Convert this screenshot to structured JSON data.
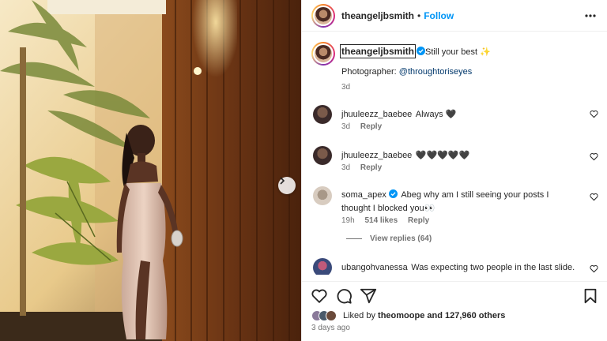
{
  "post": {
    "author": "theangeljbsmith",
    "follow_label": "Follow",
    "more_icon": "more-options-icon",
    "caption": {
      "username": "theangeljbsmith",
      "text": "Still your best ✨",
      "credit_prefix": "Photographer: ",
      "credit_handle": "@throughtoriseyes",
      "time": "3d"
    }
  },
  "comments": [
    {
      "username": "jhuuleezz_baebee",
      "text": "Always 🖤",
      "time": "3d",
      "reply": "Reply",
      "verified": false
    },
    {
      "username": "jhuuleezz_baebee",
      "text": "🖤🖤🖤🖤🖤",
      "time": "3d",
      "reply": "Reply",
      "verified": false
    },
    {
      "username": "soma_apex",
      "text": "Abeg why am I still seeing your posts I thought I blocked you👀",
      "time": "19h",
      "likes": "514 likes",
      "reply": "Reply",
      "verified": true
    },
    {
      "username": "ubangohvanessa",
      "text": "Was expecting two people in the last slide.",
      "time": "",
      "reply": "",
      "verified": false
    }
  ],
  "view_replies": "View replies (64)",
  "likes": {
    "prefix": "Liked by ",
    "user": "theomoope",
    "suffix": " and 127,960 others"
  },
  "date": "3 days ago",
  "colors": {
    "link_blue": "#0095f6",
    "verified_blue": "#0095f6",
    "text": "#262626",
    "muted": "#737373"
  },
  "icons": {
    "like": "heart-icon",
    "comment": "comment-icon",
    "share": "share-icon",
    "save": "bookmark-icon",
    "next": "chevron-right-icon"
  }
}
